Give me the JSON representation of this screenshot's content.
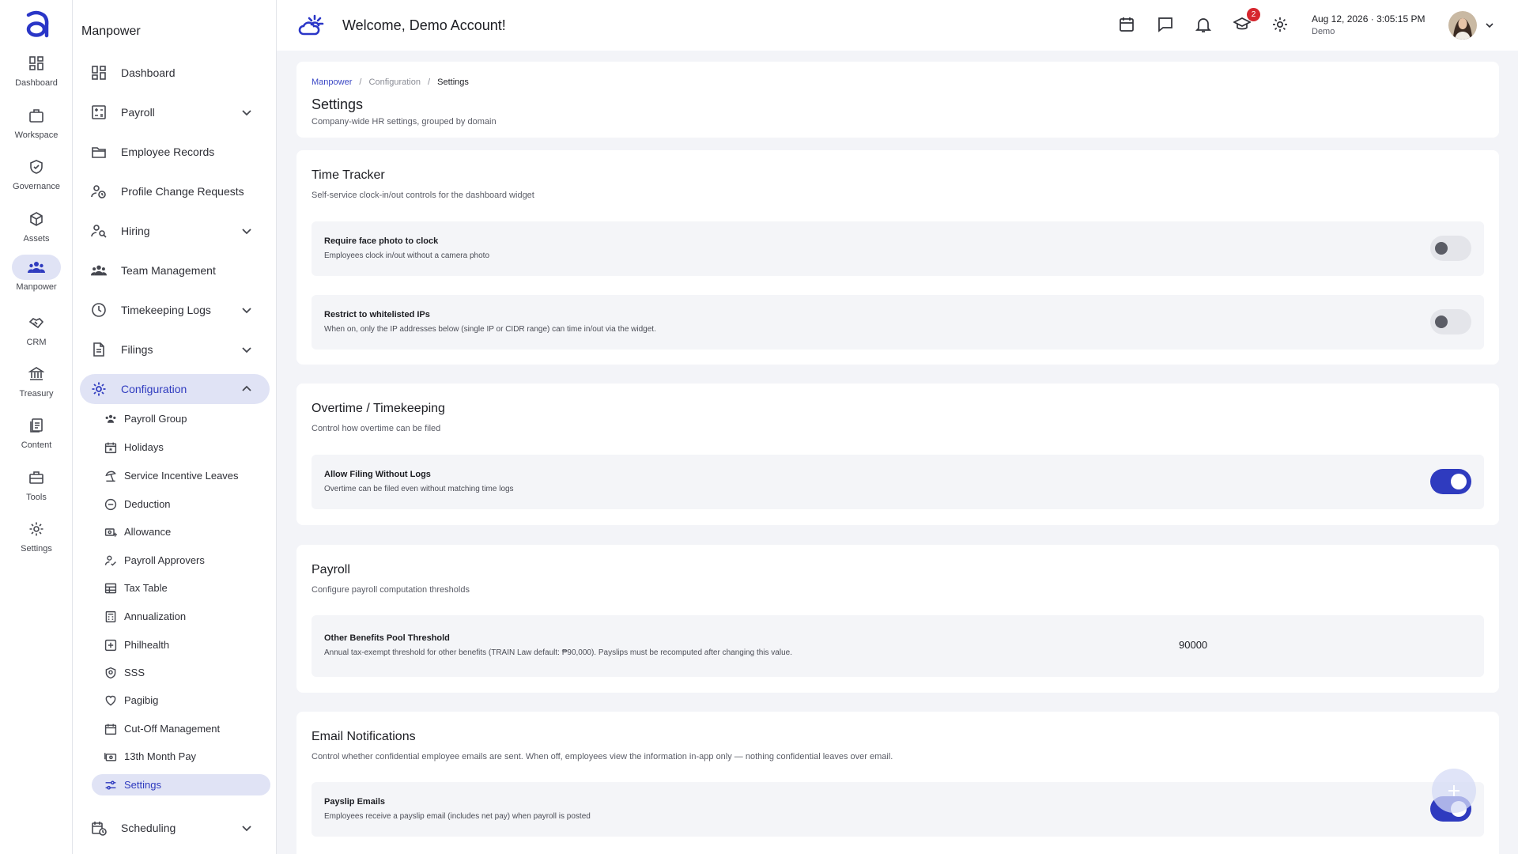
{
  "rail": [
    {
      "label": "Dashboard",
      "icon": "dashboard-icon"
    },
    {
      "label": "Workspace",
      "icon": "briefcase-icon"
    },
    {
      "label": "Governance",
      "icon": "shield-check-icon"
    },
    {
      "label": "Assets",
      "icon": "box-icon"
    },
    {
      "label": "Manpower",
      "icon": "people-icon"
    },
    {
      "label": "CRM",
      "icon": "handshake-icon"
    },
    {
      "label": "Treasury",
      "icon": "bank-icon"
    },
    {
      "label": "Content",
      "icon": "documents-icon"
    },
    {
      "label": "Tools",
      "icon": "toolbox-icon"
    },
    {
      "label": "Settings",
      "icon": "gear-icon"
    }
  ],
  "sidebar": {
    "title": "Manpower",
    "items": [
      {
        "label": "Dashboard",
        "icon": "dashboard-icon"
      },
      {
        "label": "Payroll",
        "icon": "payroll-icon"
      },
      {
        "label": "Employee Records",
        "icon": "folder-open-icon"
      },
      {
        "label": "Profile Change Requests",
        "icon": "person-clock-icon"
      },
      {
        "label": "Hiring",
        "icon": "person-search-icon"
      },
      {
        "label": "Team Management",
        "icon": "team-icon"
      },
      {
        "label": "Timekeeping Logs",
        "icon": "clock-icon"
      },
      {
        "label": "Filings",
        "icon": "file-icon"
      },
      {
        "label": "Configuration",
        "icon": "gear-icon"
      },
      {
        "label": "Scheduling",
        "icon": "calendar-clock-icon"
      }
    ],
    "sub_items": [
      {
        "label": "Payroll Group",
        "icon": "group-icon"
      },
      {
        "label": "Holidays",
        "icon": "calendar-star-icon"
      },
      {
        "label": "Service Incentive Leaves",
        "icon": "beach-umbrella-icon"
      },
      {
        "label": "Deduction",
        "icon": "minus-circle-icon"
      },
      {
        "label": "Allowance",
        "icon": "money-add-icon"
      },
      {
        "label": "Payroll Approvers",
        "icon": "person-check-icon"
      },
      {
        "label": "Tax Table",
        "icon": "table-icon"
      },
      {
        "label": "Annualization",
        "icon": "calculator-icon"
      },
      {
        "label": "Philhealth",
        "icon": "medical-cross-icon"
      },
      {
        "label": "SSS",
        "icon": "badge-shield-icon"
      },
      {
        "label": "Pagibig",
        "icon": "heart-icon"
      },
      {
        "label": "Cut-Off Management",
        "icon": "calendar-icon"
      },
      {
        "label": "13th Month Pay",
        "icon": "money-icon"
      },
      {
        "label": "Settings",
        "icon": "sliders-icon"
      }
    ]
  },
  "topbar": {
    "welcome": "Welcome, Demo Account!",
    "notification_count": "2",
    "date": "Aug 12, 2026",
    "separator": "·",
    "time": "3:05:15 PM",
    "user": "Demo"
  },
  "page": {
    "breadcrumb": [
      "Manpower",
      "/",
      "Configuration",
      "/",
      "Settings"
    ],
    "title": "Settings",
    "subtitle": "Company-wide HR settings, grouped by domain"
  },
  "sections": {
    "time_tracker": {
      "title": "Time Tracker",
      "subtitle": "Self-service clock-in/out controls for the dashboard widget",
      "rows": [
        {
          "title": "Require face photo to clock",
          "desc": "Employees clock in/out without a camera photo",
          "on": false
        },
        {
          "title": "Restrict to whitelisted IPs",
          "desc": "When on, only the IP addresses below (single IP or CIDR range) can time in/out via the widget.",
          "on": false
        }
      ]
    },
    "overtime": {
      "title": "Overtime / Timekeeping",
      "subtitle": "Control how overtime can be filed",
      "rows": [
        {
          "title": "Allow Filing Without Logs",
          "desc": "Overtime can be filed even without matching time logs",
          "on": true
        }
      ]
    },
    "payroll": {
      "title": "Payroll",
      "subtitle": "Configure payroll computation thresholds",
      "rows": [
        {
          "title": "Other Benefits Pool Threshold",
          "desc": "Annual tax-exempt threshold for other benefits (TRAIN Law default: ₱90,000). Payslips must be recomputed after changing this value.",
          "value": "90000"
        }
      ]
    },
    "email": {
      "title": "Email Notifications",
      "subtitle": "Control whether confidential employee emails are sent. When off, employees view the information in-app only — nothing confidential leaves over email.",
      "rows": [
        {
          "title": "Payslip Emails",
          "desc": "Employees receive a payslip email (includes net pay) when payroll is posted",
          "on": true
        }
      ]
    }
  },
  "colors": {
    "accent": "#2f3bbf",
    "accent_bg": "#e0e3f5",
    "badge": "#d6262e"
  }
}
